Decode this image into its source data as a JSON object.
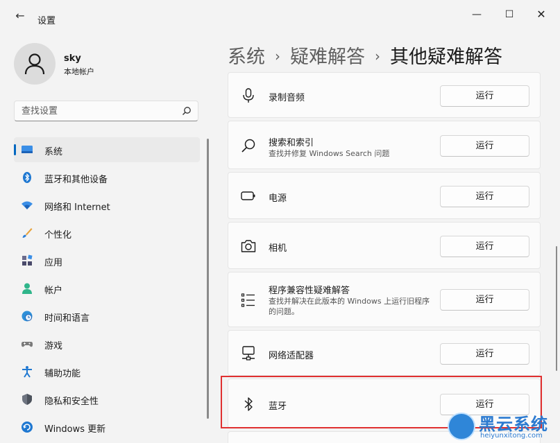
{
  "window": {
    "title": "设置",
    "back_glyph": "←",
    "minimize_glyph": "—",
    "maximize_glyph": "☐",
    "close_glyph": "✕"
  },
  "user": {
    "name": "sky",
    "account_type": "本地帐户",
    "avatar_icon": "person-icon"
  },
  "search": {
    "placeholder": "查找设置",
    "icon": "search-icon"
  },
  "nav": {
    "items": [
      {
        "label": "系统",
        "icon": "monitor-icon",
        "active": true
      },
      {
        "label": "蓝牙和其他设备",
        "icon": "bluetooth-icon"
      },
      {
        "label": "网络和 Internet",
        "icon": "wifi-icon"
      },
      {
        "label": "个性化",
        "icon": "brush-icon"
      },
      {
        "label": "应用",
        "icon": "apps-icon"
      },
      {
        "label": "帐户",
        "icon": "account-icon"
      },
      {
        "label": "时间和语言",
        "icon": "globe-clock-icon"
      },
      {
        "label": "游戏",
        "icon": "gamepad-icon"
      },
      {
        "label": "辅助功能",
        "icon": "accessibility-icon"
      },
      {
        "label": "隐私和安全性",
        "icon": "shield-icon"
      },
      {
        "label": "Windows 更新",
        "icon": "update-icon"
      }
    ]
  },
  "breadcrumb": {
    "part1": "系统",
    "part2": "疑难解答",
    "current": "其他疑难解答",
    "separator": "›"
  },
  "troubleshooters": [
    {
      "title": "录制音频",
      "description": "",
      "icon": "microphone-icon",
      "button": "运行"
    },
    {
      "title": "搜索和索引",
      "description": "查找并修复 Windows Search 问题",
      "icon": "search-icon",
      "button": "运行"
    },
    {
      "title": "电源",
      "description": "",
      "icon": "battery-icon",
      "button": "运行"
    },
    {
      "title": "相机",
      "description": "",
      "icon": "camera-icon",
      "button": "运行"
    },
    {
      "title": "程序兼容性疑难解答",
      "description": "查找并解决在此版本的 Windows 上运行旧程序的问题。",
      "icon": "list-icon",
      "button": "运行"
    },
    {
      "title": "网络适配器",
      "description": "",
      "icon": "network-adapter-icon",
      "button": "运行"
    },
    {
      "title": "蓝牙",
      "description": "",
      "icon": "bluetooth-icon",
      "button": "运行",
      "highlighted": true
    }
  ],
  "watermark": {
    "brand": "黑云系统",
    "url": "heiyunxitong.com"
  },
  "colors": {
    "accent": "#0067c0",
    "highlight_border": "#e03030",
    "watermark": "#2b7ad0"
  }
}
